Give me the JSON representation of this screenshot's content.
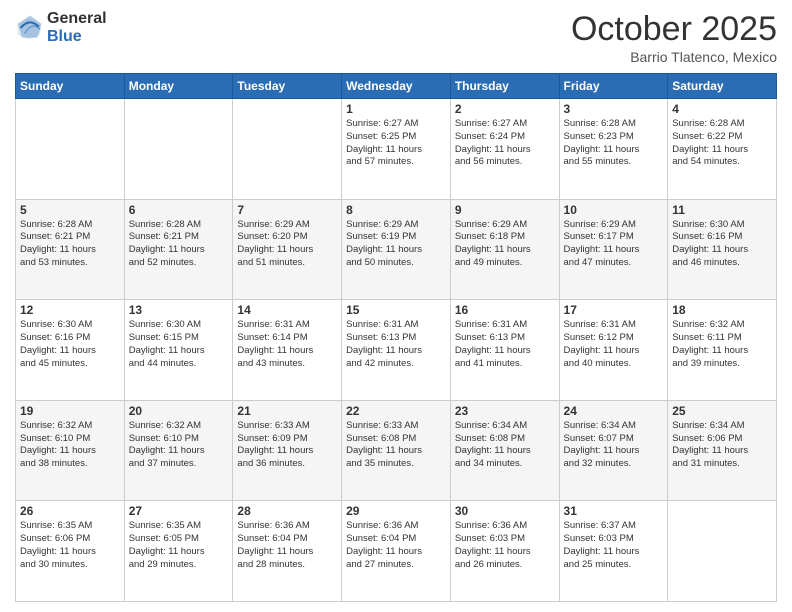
{
  "logo": {
    "general": "General",
    "blue": "Blue"
  },
  "header": {
    "month": "October 2025",
    "location": "Barrio Tlatenco, Mexico"
  },
  "weekdays": [
    "Sunday",
    "Monday",
    "Tuesday",
    "Wednesday",
    "Thursday",
    "Friday",
    "Saturday"
  ],
  "weeks": [
    [
      {
        "day": "",
        "info": ""
      },
      {
        "day": "",
        "info": ""
      },
      {
        "day": "",
        "info": ""
      },
      {
        "day": "1",
        "info": "Sunrise: 6:27 AM\nSunset: 6:25 PM\nDaylight: 11 hours\nand 57 minutes."
      },
      {
        "day": "2",
        "info": "Sunrise: 6:27 AM\nSunset: 6:24 PM\nDaylight: 11 hours\nand 56 minutes."
      },
      {
        "day": "3",
        "info": "Sunrise: 6:28 AM\nSunset: 6:23 PM\nDaylight: 11 hours\nand 55 minutes."
      },
      {
        "day": "4",
        "info": "Sunrise: 6:28 AM\nSunset: 6:22 PM\nDaylight: 11 hours\nand 54 minutes."
      }
    ],
    [
      {
        "day": "5",
        "info": "Sunrise: 6:28 AM\nSunset: 6:21 PM\nDaylight: 11 hours\nand 53 minutes."
      },
      {
        "day": "6",
        "info": "Sunrise: 6:28 AM\nSunset: 6:21 PM\nDaylight: 11 hours\nand 52 minutes."
      },
      {
        "day": "7",
        "info": "Sunrise: 6:29 AM\nSunset: 6:20 PM\nDaylight: 11 hours\nand 51 minutes."
      },
      {
        "day": "8",
        "info": "Sunrise: 6:29 AM\nSunset: 6:19 PM\nDaylight: 11 hours\nand 50 minutes."
      },
      {
        "day": "9",
        "info": "Sunrise: 6:29 AM\nSunset: 6:18 PM\nDaylight: 11 hours\nand 49 minutes."
      },
      {
        "day": "10",
        "info": "Sunrise: 6:29 AM\nSunset: 6:17 PM\nDaylight: 11 hours\nand 47 minutes."
      },
      {
        "day": "11",
        "info": "Sunrise: 6:30 AM\nSunset: 6:16 PM\nDaylight: 11 hours\nand 46 minutes."
      }
    ],
    [
      {
        "day": "12",
        "info": "Sunrise: 6:30 AM\nSunset: 6:16 PM\nDaylight: 11 hours\nand 45 minutes."
      },
      {
        "day": "13",
        "info": "Sunrise: 6:30 AM\nSunset: 6:15 PM\nDaylight: 11 hours\nand 44 minutes."
      },
      {
        "day": "14",
        "info": "Sunrise: 6:31 AM\nSunset: 6:14 PM\nDaylight: 11 hours\nand 43 minutes."
      },
      {
        "day": "15",
        "info": "Sunrise: 6:31 AM\nSunset: 6:13 PM\nDaylight: 11 hours\nand 42 minutes."
      },
      {
        "day": "16",
        "info": "Sunrise: 6:31 AM\nSunset: 6:13 PM\nDaylight: 11 hours\nand 41 minutes."
      },
      {
        "day": "17",
        "info": "Sunrise: 6:31 AM\nSunset: 6:12 PM\nDaylight: 11 hours\nand 40 minutes."
      },
      {
        "day": "18",
        "info": "Sunrise: 6:32 AM\nSunset: 6:11 PM\nDaylight: 11 hours\nand 39 minutes."
      }
    ],
    [
      {
        "day": "19",
        "info": "Sunrise: 6:32 AM\nSunset: 6:10 PM\nDaylight: 11 hours\nand 38 minutes."
      },
      {
        "day": "20",
        "info": "Sunrise: 6:32 AM\nSunset: 6:10 PM\nDaylight: 11 hours\nand 37 minutes."
      },
      {
        "day": "21",
        "info": "Sunrise: 6:33 AM\nSunset: 6:09 PM\nDaylight: 11 hours\nand 36 minutes."
      },
      {
        "day": "22",
        "info": "Sunrise: 6:33 AM\nSunset: 6:08 PM\nDaylight: 11 hours\nand 35 minutes."
      },
      {
        "day": "23",
        "info": "Sunrise: 6:34 AM\nSunset: 6:08 PM\nDaylight: 11 hours\nand 34 minutes."
      },
      {
        "day": "24",
        "info": "Sunrise: 6:34 AM\nSunset: 6:07 PM\nDaylight: 11 hours\nand 32 minutes."
      },
      {
        "day": "25",
        "info": "Sunrise: 6:34 AM\nSunset: 6:06 PM\nDaylight: 11 hours\nand 31 minutes."
      }
    ],
    [
      {
        "day": "26",
        "info": "Sunrise: 6:35 AM\nSunset: 6:06 PM\nDaylight: 11 hours\nand 30 minutes."
      },
      {
        "day": "27",
        "info": "Sunrise: 6:35 AM\nSunset: 6:05 PM\nDaylight: 11 hours\nand 29 minutes."
      },
      {
        "day": "28",
        "info": "Sunrise: 6:36 AM\nSunset: 6:04 PM\nDaylight: 11 hours\nand 28 minutes."
      },
      {
        "day": "29",
        "info": "Sunrise: 6:36 AM\nSunset: 6:04 PM\nDaylight: 11 hours\nand 27 minutes."
      },
      {
        "day": "30",
        "info": "Sunrise: 6:36 AM\nSunset: 6:03 PM\nDaylight: 11 hours\nand 26 minutes."
      },
      {
        "day": "31",
        "info": "Sunrise: 6:37 AM\nSunset: 6:03 PM\nDaylight: 11 hours\nand 25 minutes."
      },
      {
        "day": "",
        "info": ""
      }
    ]
  ]
}
